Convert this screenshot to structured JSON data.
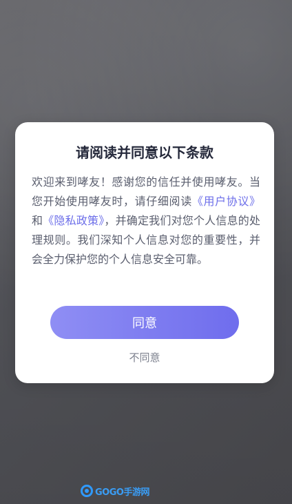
{
  "dialog": {
    "title": "请阅读并同意以下条款",
    "body": {
      "part1": "欢迎来到哮友！感谢您的信任并使用哮友。当您开始使用哮友时，请仔细阅读",
      "link_agreement": "《用户协议》",
      "part2": "和",
      "link_privacy": "《隐私政策》",
      "part3": "，并确定我们对您个人信息的处理规则。我们深知个人信息对您的重要性，并会全力保护您的个人信息安全可靠。"
    },
    "agree_label": "同意",
    "disagree_label": "不同意"
  },
  "watermark": {
    "text": "GOGO手游网",
    "icon": "gogo-logo-icon"
  },
  "colors": {
    "accent": "#6f6ded",
    "link": "#6c6ee9",
    "title": "#24283a",
    "body": "#5a5e6e"
  }
}
